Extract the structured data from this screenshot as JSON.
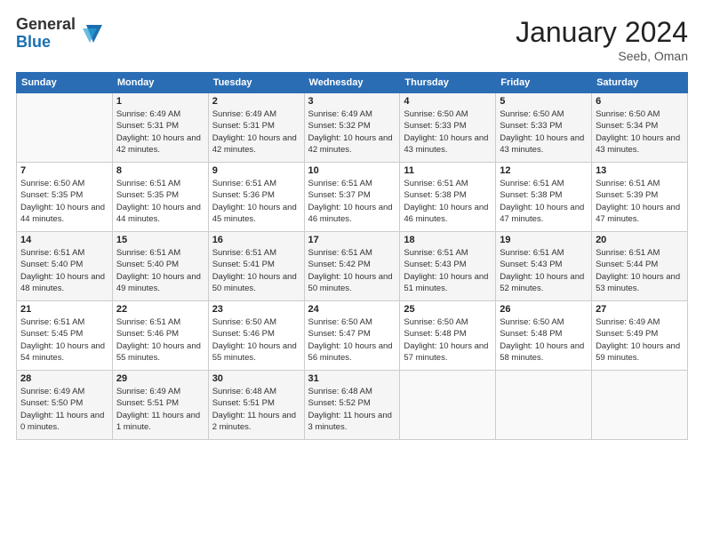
{
  "logo": {
    "general": "General",
    "blue": "Blue"
  },
  "header": {
    "month": "January 2024",
    "location": "Seeb, Oman"
  },
  "weekdays": [
    "Sunday",
    "Monday",
    "Tuesday",
    "Wednesday",
    "Thursday",
    "Friday",
    "Saturday"
  ],
  "weeks": [
    [
      {
        "day": "",
        "sunrise": "",
        "sunset": "",
        "daylight": ""
      },
      {
        "day": "1",
        "sunrise": "Sunrise: 6:49 AM",
        "sunset": "Sunset: 5:31 PM",
        "daylight": "Daylight: 10 hours and 42 minutes."
      },
      {
        "day": "2",
        "sunrise": "Sunrise: 6:49 AM",
        "sunset": "Sunset: 5:31 PM",
        "daylight": "Daylight: 10 hours and 42 minutes."
      },
      {
        "day": "3",
        "sunrise": "Sunrise: 6:49 AM",
        "sunset": "Sunset: 5:32 PM",
        "daylight": "Daylight: 10 hours and 42 minutes."
      },
      {
        "day": "4",
        "sunrise": "Sunrise: 6:50 AM",
        "sunset": "Sunset: 5:33 PM",
        "daylight": "Daylight: 10 hours and 43 minutes."
      },
      {
        "day": "5",
        "sunrise": "Sunrise: 6:50 AM",
        "sunset": "Sunset: 5:33 PM",
        "daylight": "Daylight: 10 hours and 43 minutes."
      },
      {
        "day": "6",
        "sunrise": "Sunrise: 6:50 AM",
        "sunset": "Sunset: 5:34 PM",
        "daylight": "Daylight: 10 hours and 43 minutes."
      }
    ],
    [
      {
        "day": "7",
        "sunrise": "Sunrise: 6:50 AM",
        "sunset": "Sunset: 5:35 PM",
        "daylight": "Daylight: 10 hours and 44 minutes."
      },
      {
        "day": "8",
        "sunrise": "Sunrise: 6:51 AM",
        "sunset": "Sunset: 5:35 PM",
        "daylight": "Daylight: 10 hours and 44 minutes."
      },
      {
        "day": "9",
        "sunrise": "Sunrise: 6:51 AM",
        "sunset": "Sunset: 5:36 PM",
        "daylight": "Daylight: 10 hours and 45 minutes."
      },
      {
        "day": "10",
        "sunrise": "Sunrise: 6:51 AM",
        "sunset": "Sunset: 5:37 PM",
        "daylight": "Daylight: 10 hours and 46 minutes."
      },
      {
        "day": "11",
        "sunrise": "Sunrise: 6:51 AM",
        "sunset": "Sunset: 5:38 PM",
        "daylight": "Daylight: 10 hours and 46 minutes."
      },
      {
        "day": "12",
        "sunrise": "Sunrise: 6:51 AM",
        "sunset": "Sunset: 5:38 PM",
        "daylight": "Daylight: 10 hours and 47 minutes."
      },
      {
        "day": "13",
        "sunrise": "Sunrise: 6:51 AM",
        "sunset": "Sunset: 5:39 PM",
        "daylight": "Daylight: 10 hours and 47 minutes."
      }
    ],
    [
      {
        "day": "14",
        "sunrise": "Sunrise: 6:51 AM",
        "sunset": "Sunset: 5:40 PM",
        "daylight": "Daylight: 10 hours and 48 minutes."
      },
      {
        "day": "15",
        "sunrise": "Sunrise: 6:51 AM",
        "sunset": "Sunset: 5:40 PM",
        "daylight": "Daylight: 10 hours and 49 minutes."
      },
      {
        "day": "16",
        "sunrise": "Sunrise: 6:51 AM",
        "sunset": "Sunset: 5:41 PM",
        "daylight": "Daylight: 10 hours and 50 minutes."
      },
      {
        "day": "17",
        "sunrise": "Sunrise: 6:51 AM",
        "sunset": "Sunset: 5:42 PM",
        "daylight": "Daylight: 10 hours and 50 minutes."
      },
      {
        "day": "18",
        "sunrise": "Sunrise: 6:51 AM",
        "sunset": "Sunset: 5:43 PM",
        "daylight": "Daylight: 10 hours and 51 minutes."
      },
      {
        "day": "19",
        "sunrise": "Sunrise: 6:51 AM",
        "sunset": "Sunset: 5:43 PM",
        "daylight": "Daylight: 10 hours and 52 minutes."
      },
      {
        "day": "20",
        "sunrise": "Sunrise: 6:51 AM",
        "sunset": "Sunset: 5:44 PM",
        "daylight": "Daylight: 10 hours and 53 minutes."
      }
    ],
    [
      {
        "day": "21",
        "sunrise": "Sunrise: 6:51 AM",
        "sunset": "Sunset: 5:45 PM",
        "daylight": "Daylight: 10 hours and 54 minutes."
      },
      {
        "day": "22",
        "sunrise": "Sunrise: 6:51 AM",
        "sunset": "Sunset: 5:46 PM",
        "daylight": "Daylight: 10 hours and 55 minutes."
      },
      {
        "day": "23",
        "sunrise": "Sunrise: 6:50 AM",
        "sunset": "Sunset: 5:46 PM",
        "daylight": "Daylight: 10 hours and 55 minutes."
      },
      {
        "day": "24",
        "sunrise": "Sunrise: 6:50 AM",
        "sunset": "Sunset: 5:47 PM",
        "daylight": "Daylight: 10 hours and 56 minutes."
      },
      {
        "day": "25",
        "sunrise": "Sunrise: 6:50 AM",
        "sunset": "Sunset: 5:48 PM",
        "daylight": "Daylight: 10 hours and 57 minutes."
      },
      {
        "day": "26",
        "sunrise": "Sunrise: 6:50 AM",
        "sunset": "Sunset: 5:48 PM",
        "daylight": "Daylight: 10 hours and 58 minutes."
      },
      {
        "day": "27",
        "sunrise": "Sunrise: 6:49 AM",
        "sunset": "Sunset: 5:49 PM",
        "daylight": "Daylight: 10 hours and 59 minutes."
      }
    ],
    [
      {
        "day": "28",
        "sunrise": "Sunrise: 6:49 AM",
        "sunset": "Sunset: 5:50 PM",
        "daylight": "Daylight: 11 hours and 0 minutes."
      },
      {
        "day": "29",
        "sunrise": "Sunrise: 6:49 AM",
        "sunset": "Sunset: 5:51 PM",
        "daylight": "Daylight: 11 hours and 1 minute."
      },
      {
        "day": "30",
        "sunrise": "Sunrise: 6:48 AM",
        "sunset": "Sunset: 5:51 PM",
        "daylight": "Daylight: 11 hours and 2 minutes."
      },
      {
        "day": "31",
        "sunrise": "Sunrise: 6:48 AM",
        "sunset": "Sunset: 5:52 PM",
        "daylight": "Daylight: 11 hours and 3 minutes."
      },
      {
        "day": "",
        "sunrise": "",
        "sunset": "",
        "daylight": ""
      },
      {
        "day": "",
        "sunrise": "",
        "sunset": "",
        "daylight": ""
      },
      {
        "day": "",
        "sunrise": "",
        "sunset": "",
        "daylight": ""
      }
    ]
  ]
}
